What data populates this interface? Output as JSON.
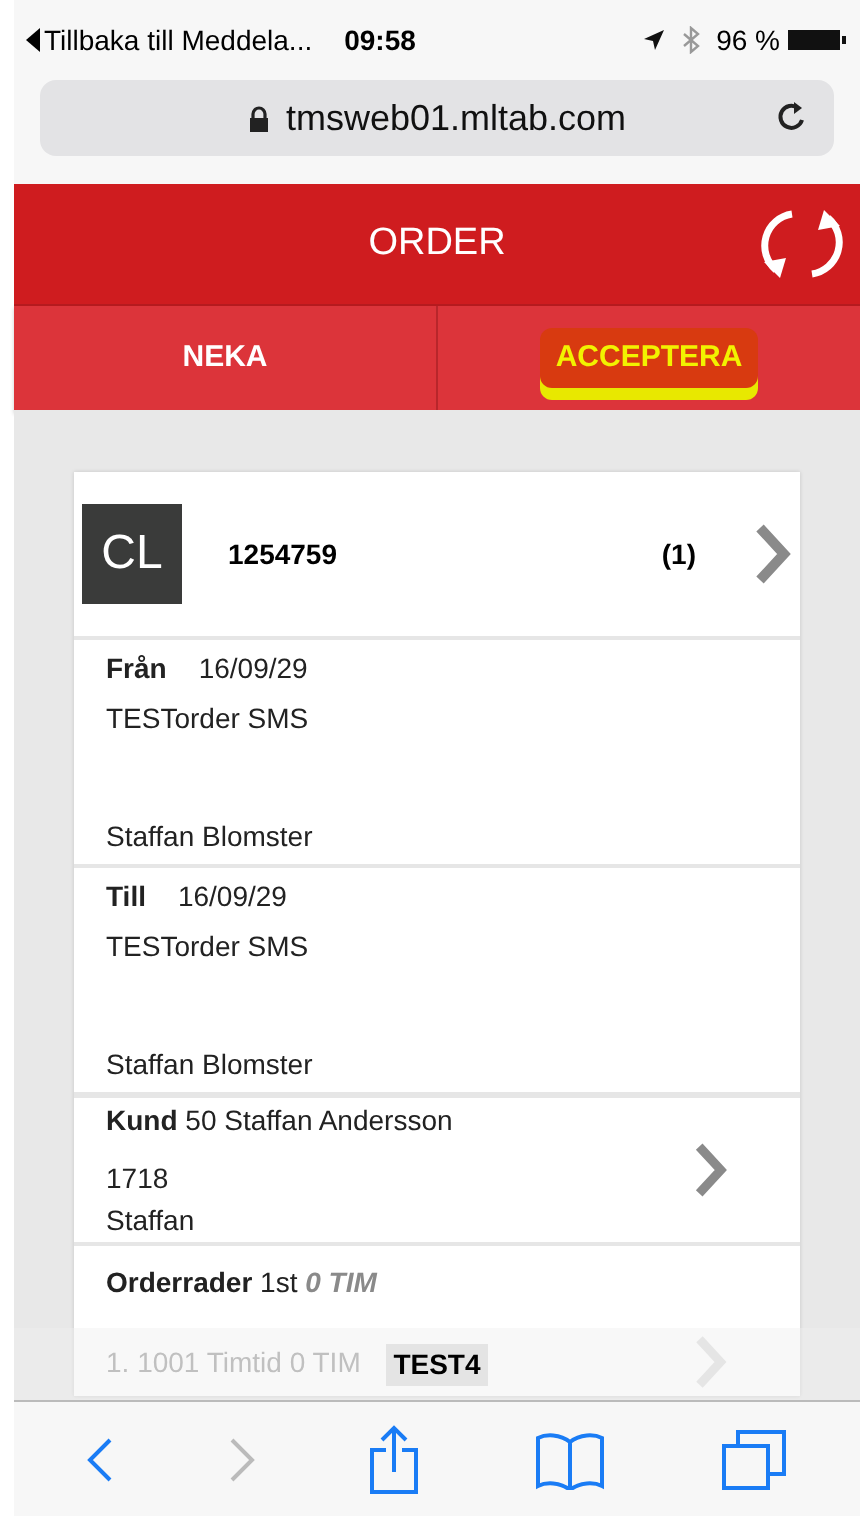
{
  "status_bar": {
    "back_link": "Tillbaka till Meddela...",
    "time": "09:58",
    "battery": "96 %"
  },
  "address_bar": {
    "url": "tmsweb01.mltab.com"
  },
  "header": {
    "title": "ORDER"
  },
  "actions": [
    {
      "label": "NEKA",
      "highlighted": false
    },
    {
      "label": "ACCEPTERA",
      "highlighted": true
    }
  ],
  "order": {
    "avatar": "CL",
    "number": "1254759",
    "count": "(1)",
    "sections": [
      {
        "kind": "stop",
        "label": "Från",
        "date": "16/09/29",
        "lines": [
          "TESTorder SMS"
        ],
        "contact": "Staffan Blomster"
      },
      {
        "kind": "stop",
        "label": "Till",
        "date": "16/09/29",
        "lines": [
          "TESTorder SMS"
        ],
        "contact": "Staffan Blomster"
      },
      {
        "kind": "customer",
        "label": "Kund",
        "value": "50 Staffan Andersson",
        "lines": [
          "1718",
          "Staffan"
        ]
      },
      {
        "kind": "rows",
        "label": "Orderrader",
        "value": "1st",
        "hours": "0 TIM"
      }
    ],
    "faded_row": "1. 1001 Timtid 0 TIM"
  },
  "footer_label": "TEST4"
}
